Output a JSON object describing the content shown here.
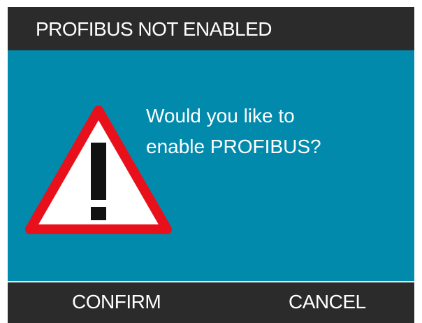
{
  "dialog": {
    "title": "PROFIBUS NOT ENABLED",
    "message_line1": "Would you like to",
    "message_line2": "enable PROFIBUS?",
    "icon": "warning-icon"
  },
  "buttons": {
    "confirm_label": "CONFIRM",
    "cancel_label": "CANCEL"
  },
  "colors": {
    "header_background": "#2b2b2b",
    "content_background": "#028aad",
    "warning_border": "#e8101b",
    "text": "#ffffff"
  }
}
